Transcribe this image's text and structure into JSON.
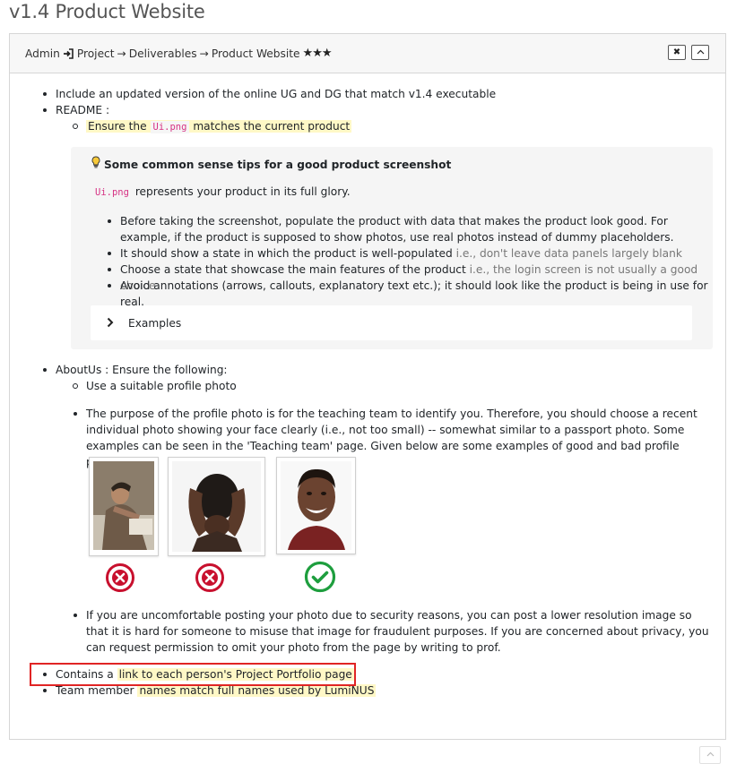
{
  "page_title": "v1.4 Product Website",
  "breadcrumb": {
    "admin": "Admin",
    "signin_icon": "sign-in-icon",
    "project": "Project",
    "arrow": "→",
    "deliverables": "Deliverables",
    "product_website": "Product Website",
    "stars": "★★★"
  },
  "header_buttons": {
    "close": "✖",
    "collapse": "^"
  },
  "items": {
    "ug_dg": "Include an updated version of the online UG and DG that match v1.4 executable",
    "readme_label": "README :",
    "readme_sub": {
      "pre": "Ensure the",
      "code": "Ui.png",
      "post": "matches the current product"
    },
    "tips": {
      "icon": "lightbulb-icon",
      "title": "Some common sense tips for a good product screenshot",
      "intro_code": "Ui.png",
      "intro_text": "represents your product in its full glory.",
      "bullets": [
        {
          "text": "Before taking the screenshot, populate the product with data that makes the product look good. For example, if the product is supposed to show photos, use real photos instead of dummy placeholders.",
          "note": ""
        },
        {
          "text": "It should show a state in which the product is well-populated",
          "note": "i.e., don't leave data panels largely blank"
        },
        {
          "text": "Choose a state that showcase the main features of the product",
          "note": "i.e., the login screen is not usually a good choice"
        },
        {
          "text": "Avoid annotations (arrows, callouts, explanatory text etc.); it should look like the product is being in use for real.",
          "note": ""
        }
      ],
      "examples_label": "Examples"
    },
    "aboutus_label": "AboutUs : Ensure the following:",
    "aboutus_sub1": "Use a suitable profile photo",
    "aboutus_sub2": "The purpose of the profile photo is for the teaching team to identify you. Therefore, you should choose a recent individual photo showing your face clearly (i.e., not too small) -- somewhat similar to a passport photo. Some examples can be seen in the 'Teaching team' page. Given below are some examples of good and bad profile photos.",
    "photos": [
      {
        "name": "photo-student-at-desk",
        "status": "bad",
        "status_icon": "cross-circle-icon"
      },
      {
        "name": "photo-hands-on-head",
        "status": "bad",
        "status_icon": "cross-circle-icon"
      },
      {
        "name": "photo-smiling-face",
        "status": "good",
        "status_icon": "check-circle-icon"
      }
    ],
    "aboutus_sub3": "If you are uncomfortable posting your photo due to security reasons, you can post a lower resolution image so that it is hard for someone to misuse that image for fraudulent purposes. If you are concerned about privacy, you can request permission to omit your photo from the page by writing to prof.",
    "portfolio": {
      "pre": "Contains a",
      "hl": "link to each person's Project Portfolio page"
    },
    "team_names": {
      "pre": "Team member",
      "hl": "names match full names used by LumiNUS"
    }
  },
  "colors": {
    "highlight": "#fff8c6",
    "code": "#d63384",
    "bad": "#c8102e",
    "good": "#1e9e3e",
    "annotation_box": "#e02424"
  },
  "scroll_top_icon": "chevron-up-icon"
}
